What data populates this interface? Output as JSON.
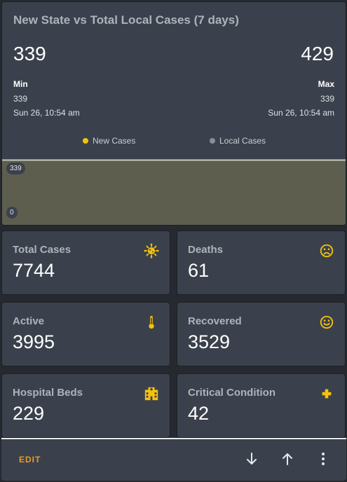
{
  "chart_card": {
    "title": "New State vs Total Local Cases (7 days)",
    "current_left": "339",
    "current_right": "429",
    "min_label": "Min",
    "min_value": "339",
    "min_time": "Sun 26, 10:54 am",
    "max_label": "Max",
    "max_value": "339",
    "max_time": "Sun 26, 10:54 am",
    "legend": [
      {
        "label": "New Cases",
        "color": "#f4c20d"
      },
      {
        "label": "Local Cases",
        "color": "#8a8e95"
      }
    ],
    "axis_max_label": "339",
    "axis_min_label": "0",
    "area_fill": "#5e5e4e",
    "area_line": "#c7c9c2"
  },
  "tiles": [
    {
      "label": "Total Cases",
      "value": "7744",
      "icon": "virus-icon"
    },
    {
      "label": "Deaths",
      "value": "61",
      "icon": "sad-face-icon"
    },
    {
      "label": "Active",
      "value": "3995",
      "icon": "thermometer-icon"
    },
    {
      "label": "Recovered",
      "value": "3529",
      "icon": "smile-face-icon"
    },
    {
      "label": "Hospital Beds",
      "value": "229",
      "icon": "hospital-icon"
    },
    {
      "label": "Critical Condition",
      "value": "42",
      "icon": "plus-icon"
    }
  ],
  "footer": {
    "edit_label": "EDIT",
    "icons": [
      "arrow-down-icon",
      "arrow-up-icon",
      "more-vertical-icon"
    ]
  },
  "colors": {
    "accent_yellow": "#f4c20d",
    "edit_orange": "#e79a2b",
    "card_bg": "#3b414c",
    "page_bg": "#262a30"
  }
}
